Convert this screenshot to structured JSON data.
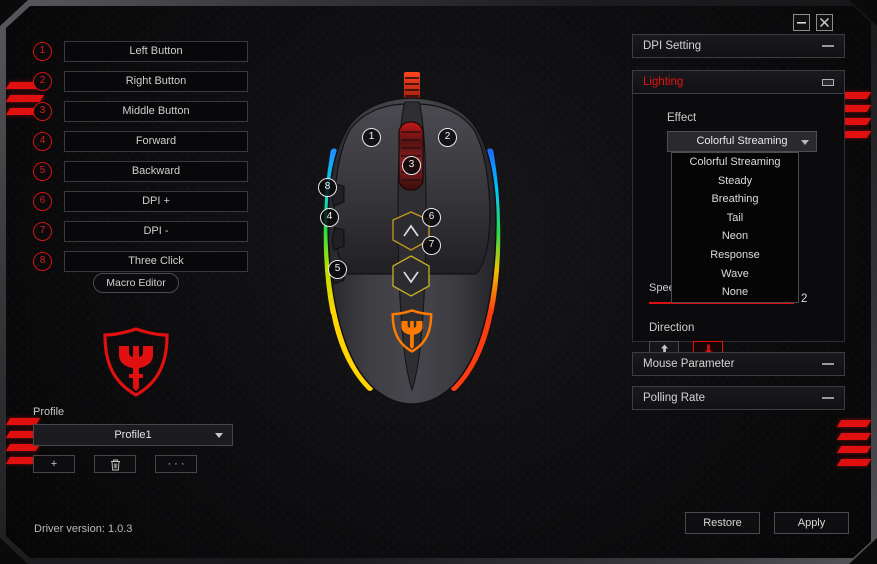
{
  "window": {
    "minimize_label": "–",
    "close_label": "×"
  },
  "buttons_panel": {
    "rows": [
      {
        "number": "1",
        "label": "Left Button"
      },
      {
        "number": "2",
        "label": "Right Button"
      },
      {
        "number": "3",
        "label": "Middle Button"
      },
      {
        "number": "4",
        "label": "Forward"
      },
      {
        "number": "5",
        "label": "Backward"
      },
      {
        "number": "6",
        "label": "DPI +"
      },
      {
        "number": "7",
        "label": "DPI -"
      },
      {
        "number": "8",
        "label": "Three Click"
      }
    ],
    "macro_editor_label": "Macro Editor"
  },
  "mouse_callouts": [
    {
      "number": "1"
    },
    {
      "number": "2"
    },
    {
      "number": "3"
    },
    {
      "number": "4"
    },
    {
      "number": "5"
    },
    {
      "number": "6"
    },
    {
      "number": "7"
    },
    {
      "number": "8"
    }
  ],
  "profile": {
    "label": "Profile",
    "selected": "Profile1",
    "add_label": "+",
    "delete_icon": "trash-icon",
    "more_label": "· · ·"
  },
  "status": {
    "driver_version": "Driver version: 1.0.3"
  },
  "right_panel": {
    "dpi_setting": {
      "title": "DPI Setting",
      "expanded": false
    },
    "lighting": {
      "title": "Lighting",
      "expanded": true,
      "effect_label": "Effect",
      "effect_selected": "Colorful Streaming",
      "effect_options": [
        "Colorful Streaming",
        "Steady",
        "Breathing",
        "Tail",
        "Neon",
        "Response",
        "Wave",
        "None"
      ],
      "speed_label": "Speed",
      "speed_value": "2",
      "direction_label": "Direction",
      "direction_up": "up-arrow-icon",
      "direction_down": "down-arrow-icon",
      "direction_selected": "down"
    },
    "mouse_parameter": {
      "title": "Mouse Parameter",
      "expanded": false
    },
    "polling_rate": {
      "title": "Polling Rate",
      "expanded": false
    }
  },
  "actions": {
    "restore_label": "Restore",
    "apply_label": "Apply"
  },
  "colors": {
    "accent_red": "#e01010",
    "panel_bg": "#0b0b0d",
    "text": "#d4d4d4"
  }
}
